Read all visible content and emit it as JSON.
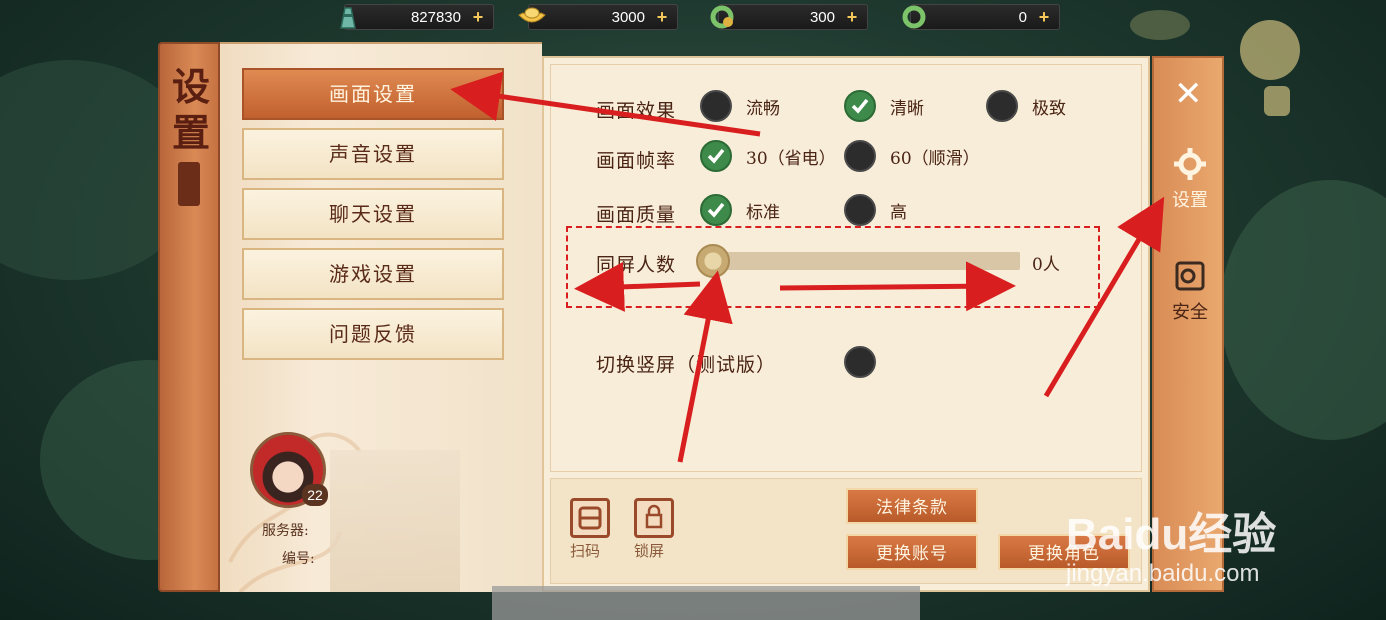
{
  "resources": [
    {
      "icon": "tower-icon",
      "value": "827830"
    },
    {
      "icon": "gold-ingot-icon",
      "value": "3000"
    },
    {
      "icon": "jade-bound-icon",
      "value": "300"
    },
    {
      "icon": "jade-icon",
      "value": "0"
    }
  ],
  "plus_label": "+",
  "panel": {
    "title": "设置",
    "menu": [
      "画面设置",
      "声音设置",
      "聊天设置",
      "游戏设置",
      "问题反馈"
    ],
    "active_menu": 0
  },
  "profile": {
    "level": "22",
    "server_label": "服务器:",
    "id_label": "编号:"
  },
  "settings": {
    "effects": {
      "label": "画面效果",
      "options": [
        "流畅",
        "清晰",
        "极致"
      ],
      "selected": 1
    },
    "framerate": {
      "label": "画面帧率",
      "options": [
        "30（省电）",
        "60（顺滑）"
      ],
      "selected": 0
    },
    "quality": {
      "label": "画面质量",
      "options": [
        "标准",
        "高"
      ],
      "selected": 0
    },
    "players": {
      "label": "同屏人数",
      "value": "0人",
      "level": 0
    },
    "portrait": {
      "label": "切换竖屏（测试版）"
    }
  },
  "bottom": {
    "scan_label": "扫码",
    "lock_label": "锁屏",
    "legal_button": "法律条款",
    "switch_account_button": "更换账号",
    "switch_role_button": "更换角色"
  },
  "tabs": [
    {
      "label": "设置",
      "icon": "gear-icon",
      "active": true
    },
    {
      "label": "安全",
      "icon": "safe-icon",
      "active": false
    }
  ],
  "watermark": {
    "logo": "Baidu经验",
    "url": "jingyan.baidu.com"
  },
  "colors": {
    "accent": "#c0602e",
    "annotation": "#d81e1e",
    "check": "#3e8a4a"
  }
}
